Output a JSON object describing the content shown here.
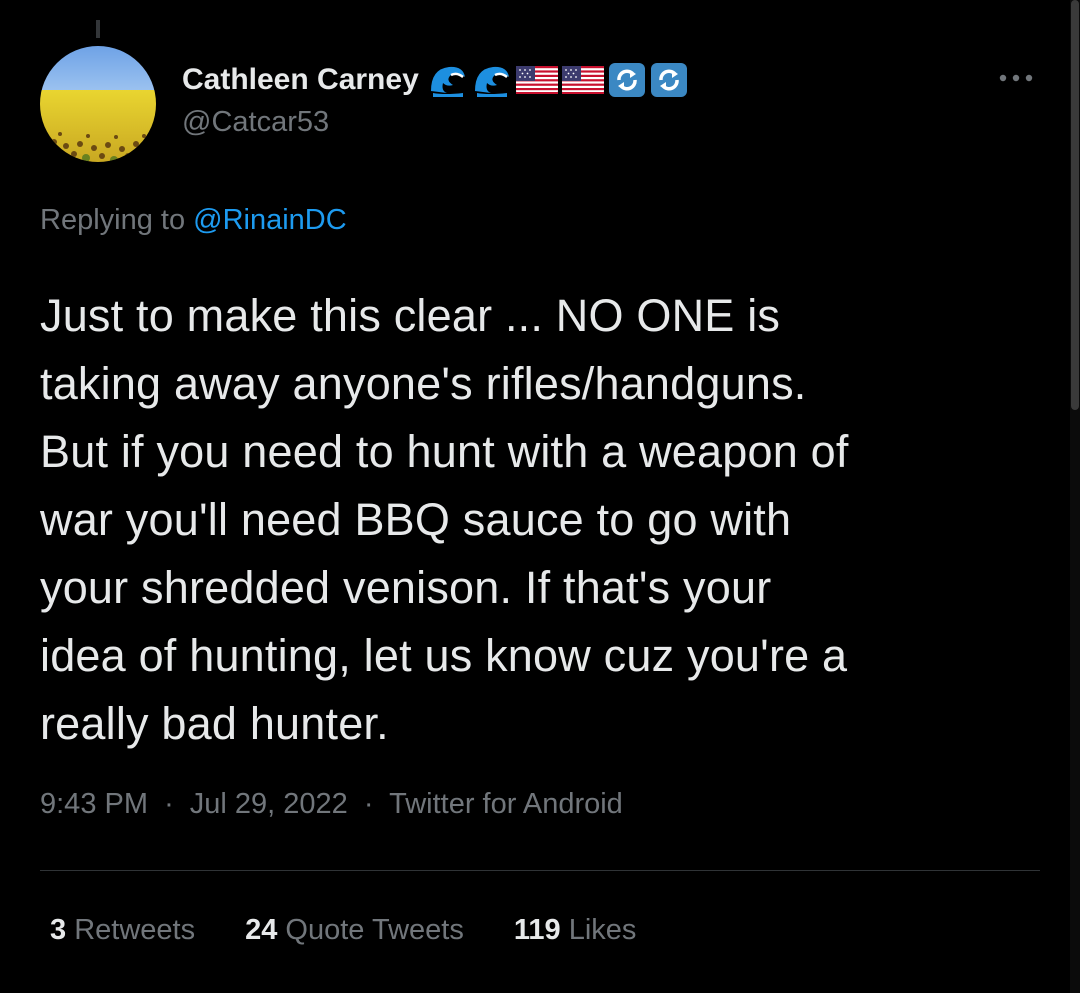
{
  "tweet": {
    "author": {
      "display_name": "Cathleen Carney",
      "handle": "@Catcar53",
      "name_emojis": [
        "wave-emoji",
        "wave-emoji",
        "us-flag-emoji",
        "us-flag-emoji",
        "arrows-cycle-emoji",
        "arrows-cycle-emoji"
      ],
      "avatar_icon": "sunflower-field-avatar"
    },
    "replying": {
      "prefix": "Replying to",
      "mention": "@RinainDC"
    },
    "text_lines": [
      "Just to make this clear ... NO ONE is",
      "taking away anyone's rifles/handguns.",
      "But if you need to hunt with a weapon of",
      "war you'll need BBQ sauce to go with",
      "your shredded venison. If that's your",
      "idea of hunting, let us know cuz you're a",
      "really bad hunter."
    ],
    "meta": {
      "time": "9:43 PM",
      "separator": "·",
      "date": "Jul 29, 2022",
      "source": "Twitter for Android"
    },
    "stats": {
      "retweets_count": "3",
      "retweets_label": "Retweets",
      "quotes_count": "24",
      "quotes_label": "Quote Tweets",
      "likes_count": "119",
      "likes_label": "Likes"
    }
  },
  "icons": {
    "more": "more-icon"
  },
  "colors": {
    "background": "#000000",
    "text_primary": "#e7e9ea",
    "text_secondary": "#71767b",
    "link": "#1d9bf0",
    "divider": "#2f3336"
  }
}
